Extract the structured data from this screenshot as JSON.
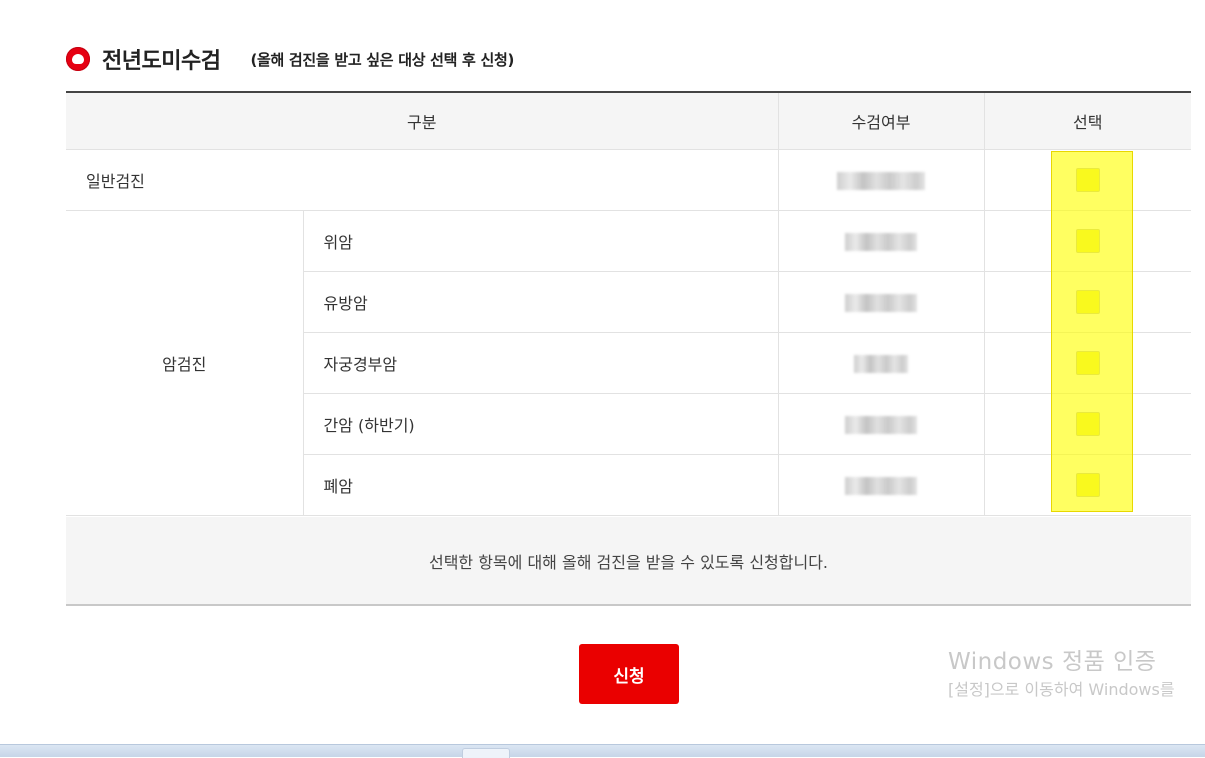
{
  "section": {
    "title": "전년도미수검",
    "subtitle": "(올해 검진을 받고 싶은 대상 선택 후 신청)"
  },
  "table": {
    "headers": {
      "category": "구분",
      "status": "수검여부",
      "select": "선택"
    },
    "general_row": {
      "label": "일반검진"
    },
    "cancer_group": {
      "label": "암검진",
      "items": [
        {
          "label": "위암"
        },
        {
          "label": "유방암"
        },
        {
          "label": "자궁경부암"
        },
        {
          "label": "간암 (하반기)"
        },
        {
          "label": "폐암"
        }
      ]
    }
  },
  "notice": "선택한 항목에 대해 올해 검진을 받을 수 있도록 신청합니다.",
  "apply_button": "신청",
  "watermark": {
    "line1": "Windows 정품 인증",
    "line2": "[설정]으로 이동하여 Windows를"
  },
  "colors": {
    "accent": "#ea0000",
    "highlight": "#ffff00"
  }
}
